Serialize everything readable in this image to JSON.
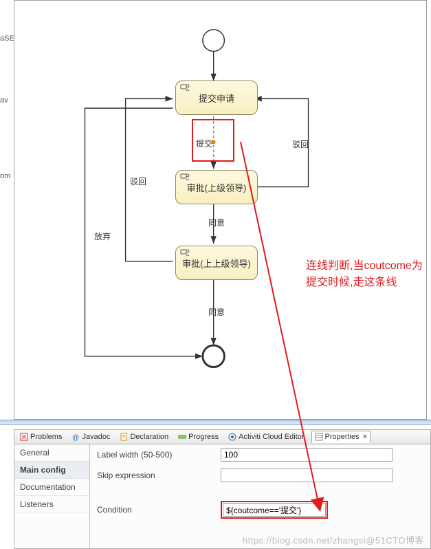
{
  "sidebar_fragments": {
    "a": "aSE",
    "b": "av",
    "c": "om"
  },
  "flow": {
    "task1": "提交申请",
    "task2": "审批(上级领导)",
    "task3": "审批(上上级领导)",
    "edge_submit": "提交",
    "edge_reject1": "驳回",
    "edge_reject2": "驳回",
    "edge_agree1": "同意",
    "edge_agree2": "同意",
    "edge_abandon": "放弃"
  },
  "annotation": "连线判断,当coutcome为提交时候,走这条线",
  "tabs": {
    "problems": "Problems",
    "javadoc": "Javadoc",
    "declaration": "Declaration",
    "progress": "Progress",
    "activiti": "Activiti Cloud Editor",
    "properties": "Properties"
  },
  "props_side": {
    "general": "General",
    "main": "Main config",
    "doc": "Documentation",
    "listeners": "Listeners"
  },
  "form": {
    "label_width_label": "Label width (50-500)",
    "label_width_value": "100",
    "skip_label": "Skip expression",
    "skip_value": "",
    "condition_label": "Condition",
    "condition_value": "${coutcome=='提交'}"
  },
  "watermark": "https://blog.csdn.net/zhangsi@51CTO博客"
}
